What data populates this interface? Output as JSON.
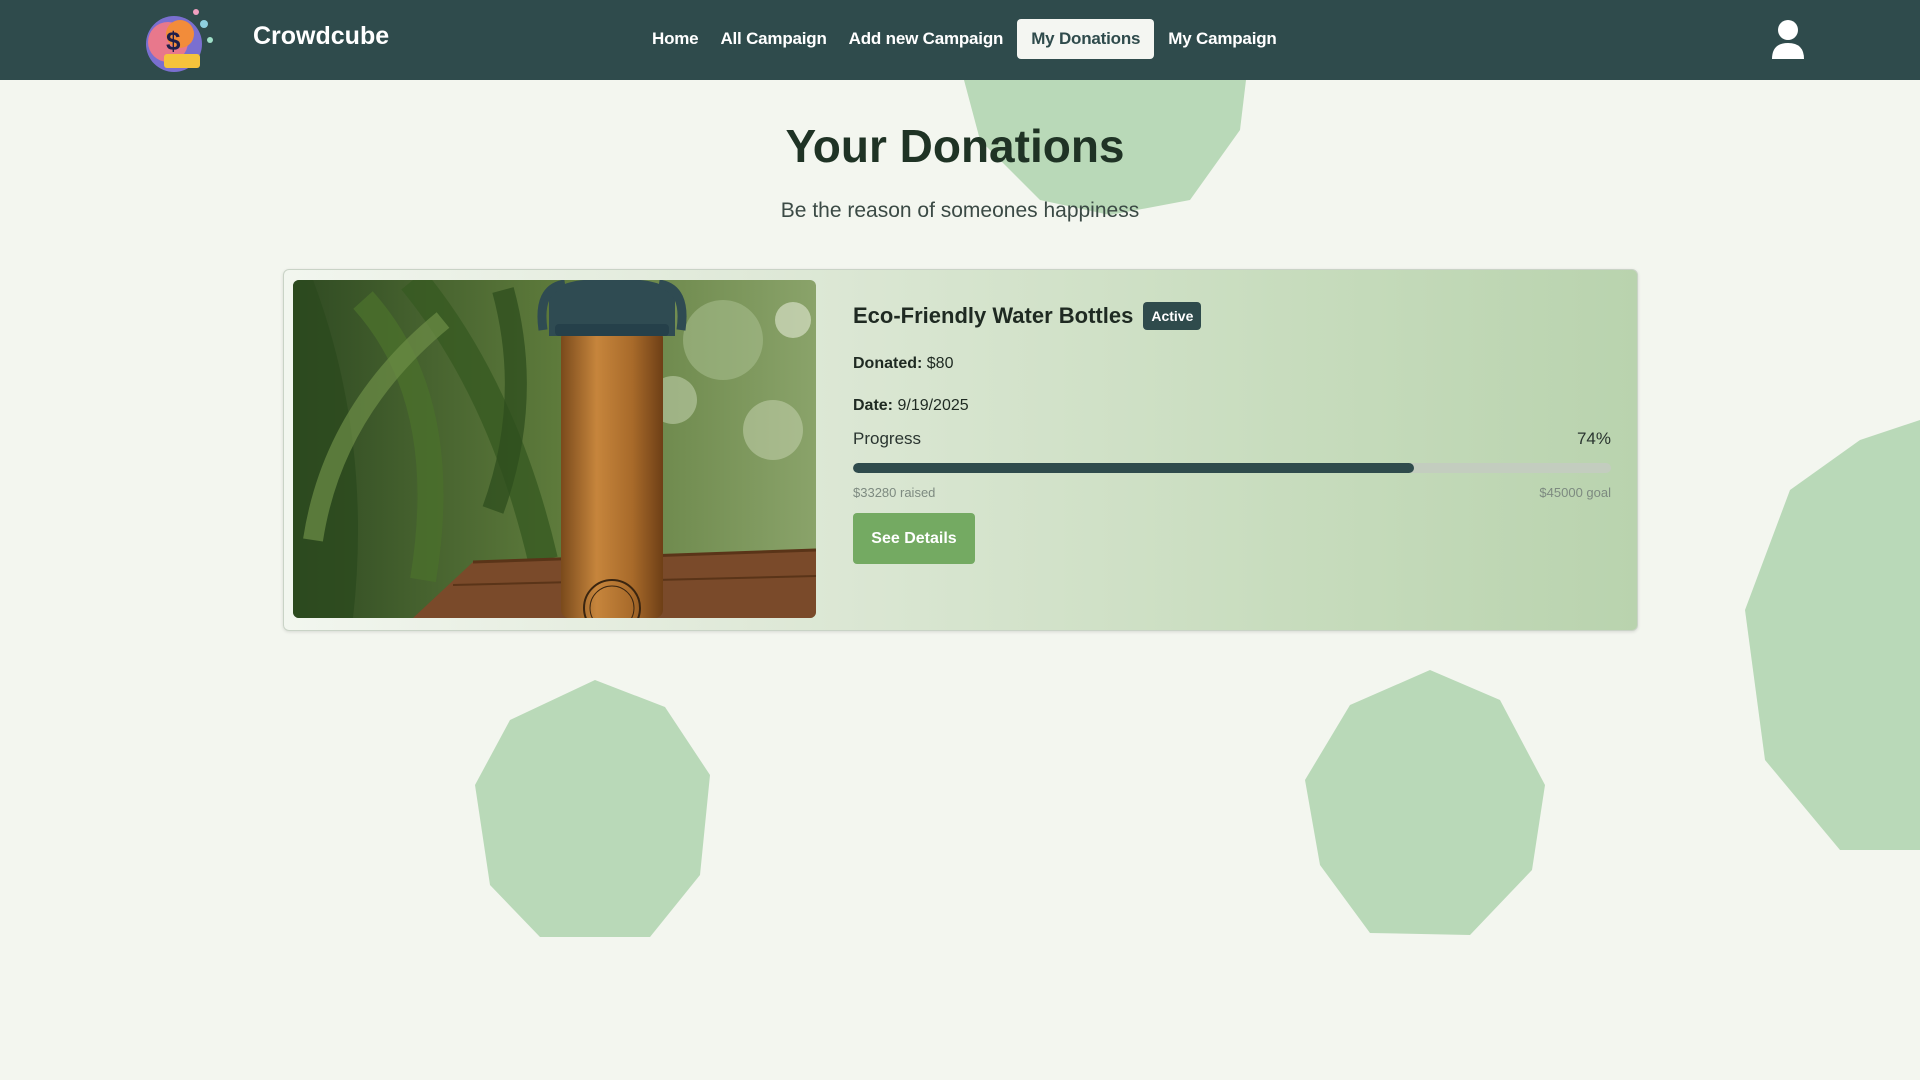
{
  "navbar": {
    "brand": "Crowdcube",
    "links": [
      {
        "label": "Home",
        "active": false
      },
      {
        "label": "All Campaign",
        "active": false
      },
      {
        "label": "Add new Campaign",
        "active": false
      },
      {
        "label": "My Donations",
        "active": true
      },
      {
        "label": "My Campaign",
        "active": false
      }
    ],
    "logo_icon": "crowdfunding-logo-icon",
    "avatar_icon": "user-icon"
  },
  "page": {
    "title": "Your Donations",
    "subtitle": "Be the reason of someones happiness"
  },
  "donations": [
    {
      "campaign_title": "Eco-Friendly Water Bottles",
      "status": "Active",
      "donated_label": "Donated:",
      "donated_value": "$80",
      "date_label": "Date:",
      "date_value": "9/19/2025",
      "progress_label": "Progress",
      "progress_percent_text": "74%",
      "progress_fraction": 0.74,
      "raised_text": "$33280 raised",
      "goal_text": "$45000 goal",
      "button_label": "See Details",
      "image_icon": "water-bottle-photo"
    }
  ],
  "colors": {
    "navbar_bg": "#2f4b4c",
    "page_bg": "#f3f6ef",
    "accent_green": "#74aa62",
    "shape_green": "#b9d9b8",
    "badge_bg": "#2f4b4c"
  }
}
